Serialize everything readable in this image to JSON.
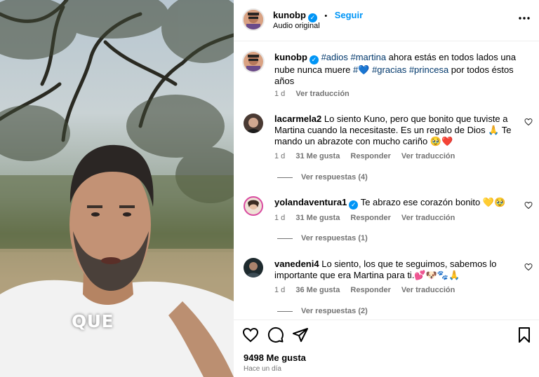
{
  "video": {
    "caption": "QUE"
  },
  "header": {
    "username": "kunobp",
    "separator": "•",
    "follow_label": "Seguir",
    "audio": "Audio original"
  },
  "post_caption": {
    "username": "kunobp",
    "tags1": "#adios #martina",
    "text1": " ahora estás en todos lados una nube nunca muere ",
    "tag2": "#",
    "heart": "💙",
    "tags3": " #gracias #princesa",
    "text2": " por todos éstos años",
    "time": "1 d",
    "translate": "Ver traducción"
  },
  "comments": [
    {
      "username": "lacarmela2",
      "text": "Lo siento Kuno, pero que bonito que tuviste a Martina cuando la necesitaste. Es un regalo de Dios 🙏 Te mando un abrazote con mucho cariño 🥹❤️",
      "time": "1 d",
      "likes": "31 Me gusta",
      "reply": "Responder",
      "translate": "Ver traducción",
      "replies": "Ver respuestas (4)"
    },
    {
      "username": "yolandaventura1",
      "text": "Te abrazo ese corazón bonito 💛🥹",
      "time": "1 d",
      "likes": "31 Me gusta",
      "reply": "Responder",
      "translate": "Ver traducción",
      "replies": "Ver respuestas (1)"
    },
    {
      "username": "vanedeni4",
      "text": "Lo siento, los que te seguimos, sabemos lo importante que era Martina para ti.💕🐶🐾🙏",
      "time": "1 d",
      "likes": "36 Me gusta",
      "reply": "Responder",
      "translate": "Ver traducción",
      "replies": "Ver respuestas (2)"
    }
  ],
  "footer": {
    "likes": "9498 Me gusta",
    "when": "Hace un día"
  },
  "colors": {
    "accent": "#0095f6",
    "muted": "#737373"
  }
}
